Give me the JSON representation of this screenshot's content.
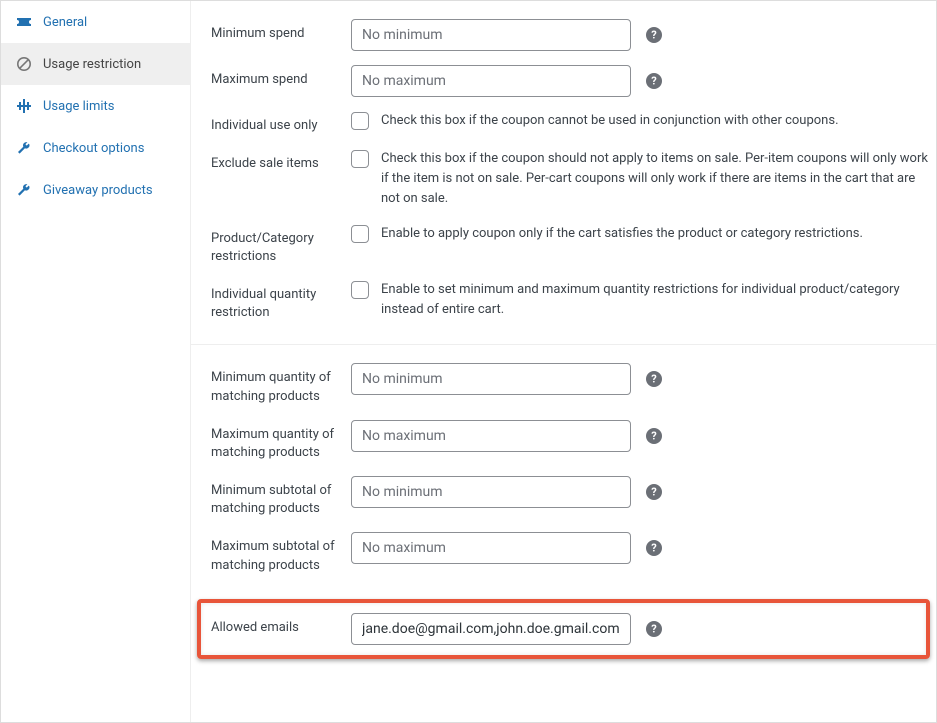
{
  "sidebar": {
    "items": [
      {
        "label": "General"
      },
      {
        "label": "Usage restriction"
      },
      {
        "label": "Usage limits"
      },
      {
        "label": "Checkout options"
      },
      {
        "label": "Giveaway products"
      }
    ]
  },
  "fields": {
    "min_spend": {
      "label": "Minimum spend",
      "placeholder": "No minimum"
    },
    "max_spend": {
      "label": "Maximum spend",
      "placeholder": "No maximum"
    },
    "individual_use": {
      "label": "Individual use only",
      "desc": "Check this box if the coupon cannot be used in conjunction with other coupons."
    },
    "exclude_sale": {
      "label": "Exclude sale items",
      "desc": "Check this box if the coupon should not apply to items on sale. Per-item coupons will only work if the item is not on sale. Per-cart coupons will only work if there are items in the cart that are not on sale."
    },
    "prod_cat_restrict": {
      "label": "Product/Category restrictions",
      "desc": "Enable to apply coupon only if the cart satisfies the product or category restrictions."
    },
    "indiv_qty_restrict": {
      "label": "Individual quantity restriction",
      "desc": "Enable to set minimum and maximum quantity restrictions for individual product/category instead of entire cart."
    },
    "min_qty": {
      "label": "Minimum quantity of matching products",
      "placeholder": "No minimum"
    },
    "max_qty": {
      "label": "Maximum quantity of matching products",
      "placeholder": "No maximum"
    },
    "min_sub": {
      "label": "Minimum subtotal of matching products",
      "placeholder": "No minimum"
    },
    "max_sub": {
      "label": "Maximum subtotal of matching products",
      "placeholder": "No maximum"
    },
    "allowed_emails": {
      "label": "Allowed emails",
      "value": "jane.doe@gmail.com,john.doe.gmail.com,"
    }
  }
}
